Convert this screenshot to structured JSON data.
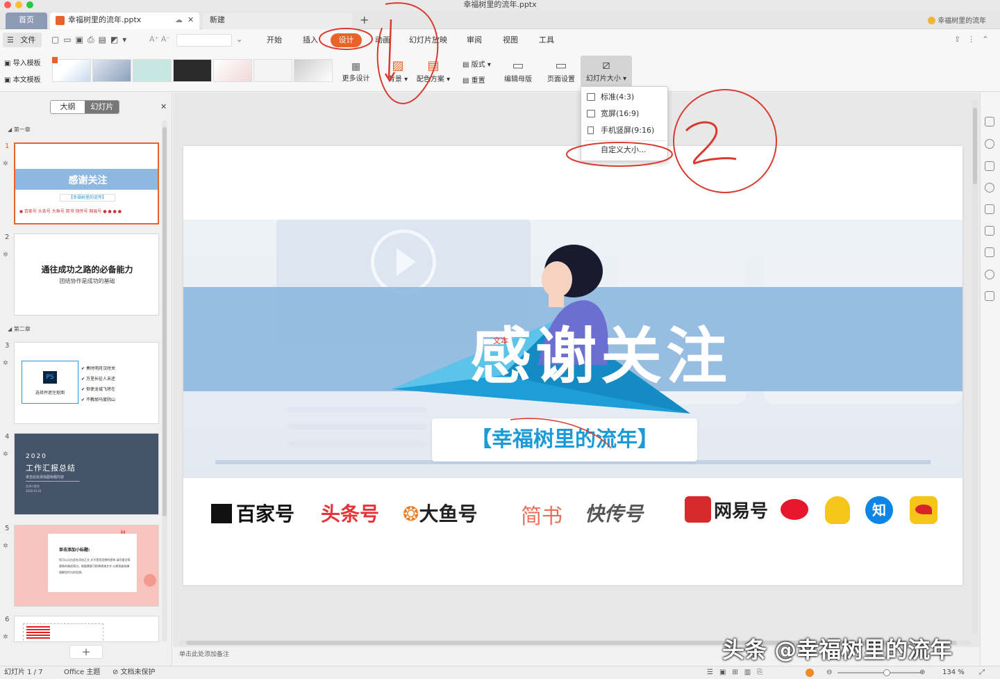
{
  "window": {
    "title": "幸福树里的流年.pptx"
  },
  "tabs": [
    {
      "label": "首页"
    },
    {
      "label": "幸福树里的流年.pptx"
    },
    {
      "label": "新建"
    }
  ],
  "account": {
    "name": "幸福树里的流年"
  },
  "menu": {
    "file": "文件",
    "items": [
      "开始",
      "插入",
      "设计",
      "动画",
      "幻灯片放映",
      "审阅",
      "视图",
      "工具"
    ]
  },
  "ribbon": {
    "import_template": "导入模板",
    "this_template": "本文模板",
    "more_design": "更多设计",
    "background": "背景",
    "color_scheme": "配色方案",
    "layout": "版式",
    "reset": "重置",
    "edit_master": "编辑母版",
    "page_setup": "页面设置",
    "slide_size": "幻灯片大小"
  },
  "dropdown": {
    "items": [
      "标准(4:3)",
      "宽屏(16:9)",
      "手机竖屏(9:16)",
      "自定义大小..."
    ]
  },
  "panel": {
    "tab_outline": "大纲",
    "tab_slides": "幻灯片",
    "section1": "第一章",
    "section2": "第二章"
  },
  "slides": [
    {
      "num": "1",
      "title": "感谢关注",
      "subtitle": "【幸福树里的流年】"
    },
    {
      "num": "2",
      "title": "通往成功之路的必备能力",
      "subtitle": "团结协作是成功的基础"
    },
    {
      "num": "3",
      "ps_label": "PS",
      "caption": "选择并遮住抠图",
      "items": [
        "奏时明月汉时关",
        "万里长征人未还",
        "但使龙城飞将在",
        "不教胡马度阴山"
      ]
    },
    {
      "num": "4",
      "year": "2020",
      "title": "工作汇报总结",
      "line1": "单击此处添加副标题内容",
      "line2": "主讲人姓名",
      "line3": "2020.01.01"
    },
    {
      "num": "5",
      "heading": "单击添加小标题:",
      "quote": "\"",
      "body": "您可以点击此处添加正文,文字是您思想的提炼,请尽量言简意赅的阐述观点。根据需要可酌情增减文字,以便观者准确理解您传达的思想。"
    },
    {
      "num": "6"
    }
  ],
  "main": {
    "title": "感谢关注",
    "subtitle": "【幸福树里的流年】",
    "watermark_small": "文本",
    "logos": [
      "百家号",
      "头条号",
      "大鱼号",
      "简书",
      "快传号",
      "网易号",
      "知"
    ]
  },
  "notes_placeholder": "单击此处添加备注",
  "status": {
    "slide": "幻灯片 1 / 7",
    "theme": "Office 主题",
    "protect": "文档未保护",
    "zoom": "134 %",
    "zoom_level": 0.6
  },
  "watermark": "头条 @幸福树里的流年",
  "colors": {
    "accent": "#e8632a",
    "annotation": "#d93a2e",
    "slide_band": "#8fb8e0",
    "title_blue": "#1a9ad6"
  }
}
